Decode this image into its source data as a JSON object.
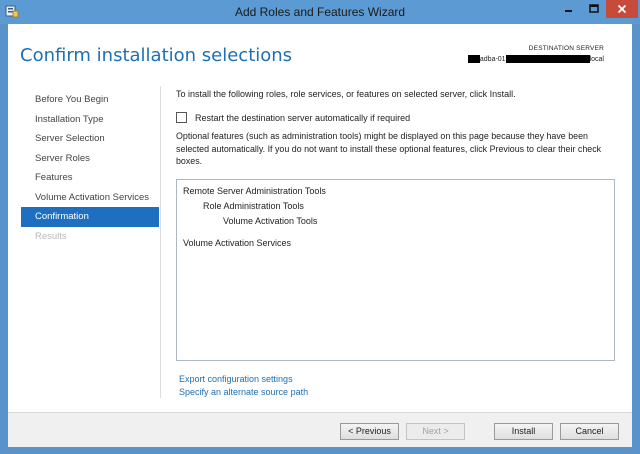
{
  "window": {
    "title": "Add Roles and Features Wizard",
    "icon": "server-manager-icon",
    "controls": [
      "minimize-icon",
      "maximize-icon",
      "close-icon"
    ]
  },
  "header": {
    "page_title": "Confirm installation selections",
    "destination_label": "DESTINATION SERVER",
    "destination_server_parts": [
      "adba-01",
      "local"
    ]
  },
  "nav": {
    "items": [
      {
        "label": "Before You Begin",
        "state": "normal"
      },
      {
        "label": "Installation Type",
        "state": "normal"
      },
      {
        "label": "Server Selection",
        "state": "normal"
      },
      {
        "label": "Server Roles",
        "state": "normal"
      },
      {
        "label": "Features",
        "state": "normal"
      },
      {
        "label": "Volume Activation Services",
        "state": "normal"
      },
      {
        "label": "Confirmation",
        "state": "active"
      },
      {
        "label": "Results",
        "state": "disabled"
      }
    ]
  },
  "main": {
    "intro": "To install the following roles, role services, or features on selected server, click Install.",
    "restart_checkbox": {
      "label": "Restart the destination server automatically if required",
      "checked": false
    },
    "optional_text": "Optional features (such as administration tools) might be displayed on this page because they have been selected automatically. If you do not want to install these optional features, click Previous to clear their check boxes.",
    "selections": [
      {
        "label": "Remote Server Administration Tools",
        "level": 0
      },
      {
        "label": "Role Administration Tools",
        "level": 1
      },
      {
        "label": "Volume Activation Tools",
        "level": 2
      },
      {
        "label": "Volume Activation Services",
        "level": 0
      }
    ],
    "links": {
      "export": "Export configuration settings",
      "alternate_source": "Specify an alternate source path"
    }
  },
  "buttons": {
    "previous": "< Previous",
    "next": "Next >",
    "install": "Install",
    "cancel": "Cancel"
  },
  "colors": {
    "accent": "#1f6fc0",
    "title_bar": "#5c9ad3",
    "close": "#c74a3a",
    "link": "#1e6fb3"
  }
}
